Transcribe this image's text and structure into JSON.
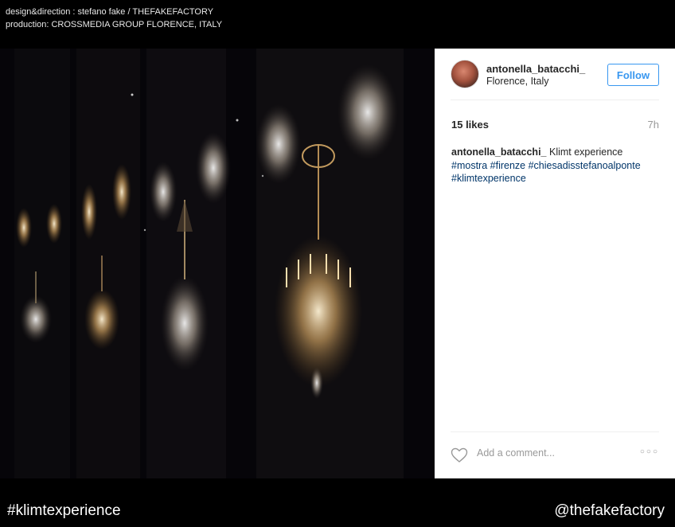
{
  "credits": {
    "line1": "design&direction : stefano fake / THEFAKEFACTORY",
    "line2": "production: CROSSMEDIA GROUP FLORENCE, ITALY"
  },
  "post": {
    "username": "antonella_batacchi_",
    "location": "Florence, Italy",
    "follow_label": "Follow",
    "likes": "15 likes",
    "time_ago": "7h",
    "caption_user": "antonella_batacchi_",
    "caption_text": "Klimt experience",
    "hashtags": [
      "#mostra",
      "#firenze",
      "#chiesadisstefanoalponte",
      "#klimtexperience"
    ],
    "comment_placeholder": "Add a comment...",
    "more_icon": "more-dots-icon",
    "heart_icon": "heart-icon"
  },
  "footer": {
    "hashtag": "#klimtexperience",
    "handle": "@thefakefactory"
  },
  "colors": {
    "follow": "#3897f0",
    "hashtag_link": "#003569",
    "background": "#000000",
    "chandelier_glow": "#f2c98a"
  }
}
